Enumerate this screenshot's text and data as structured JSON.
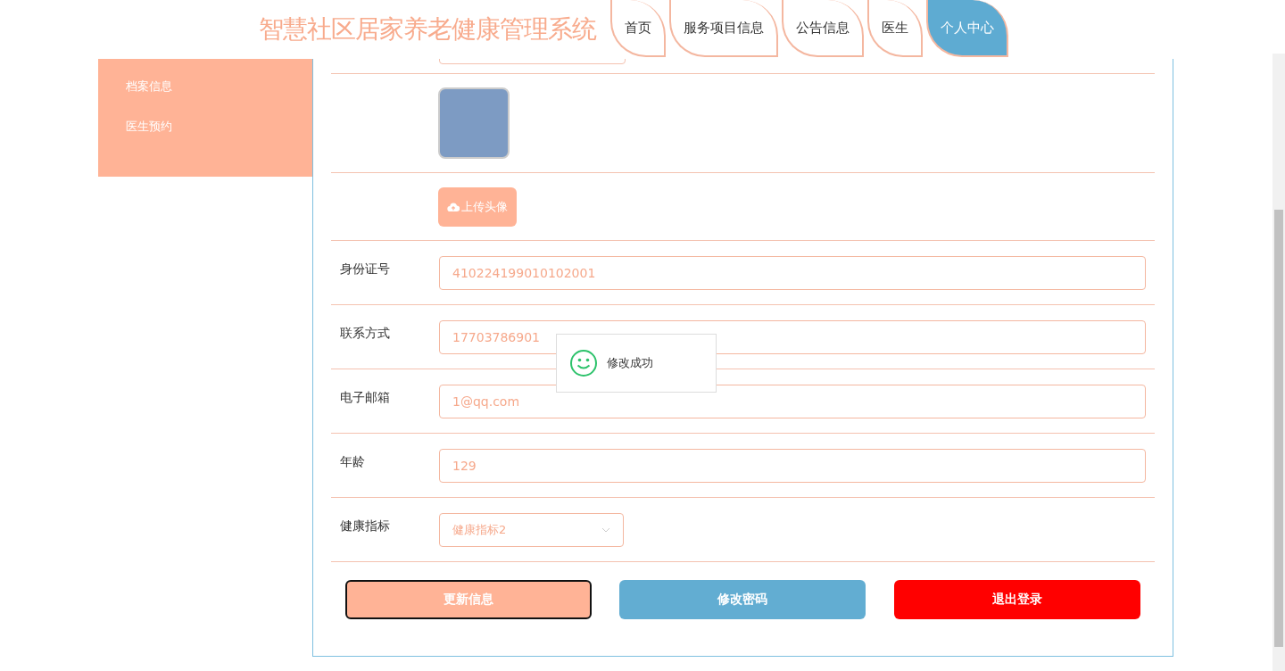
{
  "header": {
    "title": "智慧社区居家养老健康管理系统"
  },
  "nav_tabs": [
    {
      "label": "首页",
      "selected": false
    },
    {
      "label": "服务项目信息",
      "selected": false
    },
    {
      "label": "公告信息",
      "selected": false
    },
    {
      "label": "医生",
      "selected": false
    },
    {
      "label": "个人中心",
      "selected": true
    }
  ],
  "sidebar": {
    "items": [
      {
        "label": "档案信息"
      },
      {
        "label": "医生预约"
      }
    ]
  },
  "form": {
    "upload_button": "上传头像",
    "fields": [
      {
        "label": "身份证号",
        "value": "410224199010102001",
        "kind": "input"
      },
      {
        "label": "联系方式",
        "value": "17703786901",
        "kind": "input"
      },
      {
        "label": "电子邮箱",
        "value": "1@qq.com",
        "kind": "input"
      },
      {
        "label": "年龄",
        "value": "129",
        "kind": "input"
      },
      {
        "label": "健康指标",
        "value": "健康指标2",
        "kind": "select"
      }
    ],
    "buttons": [
      {
        "label": "更新信息",
        "kind": "primary"
      },
      {
        "label": "修改密码",
        "kind": "secondary"
      },
      {
        "label": "退出登录",
        "kind": "danger"
      }
    ]
  },
  "toast": {
    "message": "修改成功"
  }
}
